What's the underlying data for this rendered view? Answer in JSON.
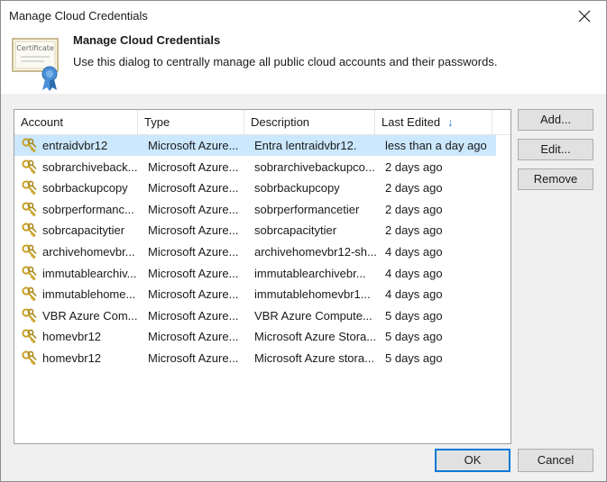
{
  "window": {
    "title": "Manage Cloud Credentials"
  },
  "header": {
    "title": "Manage Cloud Credentials",
    "subtitle": "Use this dialog to centrally manage all public cloud accounts and their passwords.",
    "icon_text": "Certificate"
  },
  "table": {
    "columns": [
      "Account",
      "Type",
      "Description",
      "Last Edited"
    ],
    "sort_column": "Last Edited",
    "sort_arrow": "↓",
    "rows": [
      {
        "account": "entraidvbr12",
        "type": "Microsoft Azure...",
        "description": "Entra lentraidvbr12.",
        "last_edited": "less than a day ago",
        "selected": true
      },
      {
        "account": "sobrarchiveback...",
        "type": "Microsoft Azure...",
        "description": "sobrarchivebackupco...",
        "last_edited": "2 days ago"
      },
      {
        "account": "sobrbackupcopy",
        "type": "Microsoft Azure...",
        "description": "sobrbackupcopy",
        "last_edited": "2 days ago"
      },
      {
        "account": "sobrperformanc...",
        "type": "Microsoft Azure...",
        "description": "sobrperformancetier",
        "last_edited": "2 days ago"
      },
      {
        "account": "sobrcapacitytier",
        "type": "Microsoft Azure...",
        "description": "sobrcapacitytier",
        "last_edited": "2 days ago"
      },
      {
        "account": "archivehomevbr...",
        "type": "Microsoft Azure...",
        "description": "archivehomevbr12-sh...",
        "last_edited": "4 days ago"
      },
      {
        "account": "immutablearchiv...",
        "type": "Microsoft Azure...",
        "description": "immutablearchivebr...",
        "last_edited": "4 days ago"
      },
      {
        "account": "immutablehome...",
        "type": "Microsoft Azure...",
        "description": "immutablehomevbr1...",
        "last_edited": "4 days ago"
      },
      {
        "account": "VBR Azure Com...",
        "type": "Microsoft Azure...",
        "description": "VBR Azure Compute...",
        "last_edited": "5 days ago"
      },
      {
        "account": "homevbr12",
        "type": "Microsoft Azure...",
        "description": "Microsoft Azure Stora...",
        "last_edited": "5 days ago"
      },
      {
        "account": "homevbr12",
        "type": "Microsoft Azure...",
        "description": "Microsoft Azure stora...",
        "last_edited": "5 days ago"
      }
    ]
  },
  "buttons": {
    "add": "Add...",
    "edit": "Edit...",
    "remove": "Remove",
    "ok": "OK",
    "cancel": "Cancel"
  },
  "colors": {
    "selection": "#cce8ff",
    "sort_arrow": "#2a7bd4",
    "key_gold": "#c9a227",
    "ribbon_blue": "#4a90d9"
  }
}
